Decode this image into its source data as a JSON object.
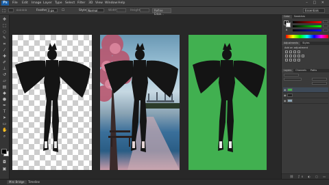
{
  "app": {
    "logo_text": "Ps"
  },
  "menu": {
    "items": [
      "File",
      "Edit",
      "Image",
      "Layer",
      "Type",
      "Select",
      "Filter",
      "3D",
      "View",
      "Window",
      "Help"
    ]
  },
  "window_controls": "–  □  ✕",
  "options_bar": {
    "feather_label": "Feather:",
    "feather_value": "0 px",
    "style_label": "Style:",
    "style_value": "Normal",
    "width_label": "Width:",
    "height_label": "Height:",
    "refine_edge_label": "Refine Edge...",
    "workspace_label": "Essentials"
  },
  "panels": {
    "color": {
      "tabs": [
        "Color",
        "Swatches"
      ]
    },
    "adjustments": {
      "tabs": [
        "Adjustments",
        "Styles"
      ],
      "hint": "Add an adjustment"
    },
    "layers": {
      "tabs": [
        "Layers",
        "Channels",
        "Paths"
      ]
    }
  },
  "bottom_tabs": [
    "Mini Bridge",
    "Timeline"
  ],
  "colors": {
    "green_screen": "#41b050",
    "accent_blue": "#1b5fa6"
  }
}
